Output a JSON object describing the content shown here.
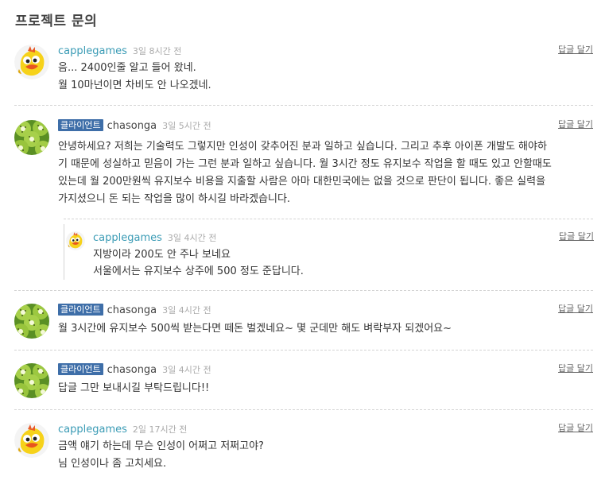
{
  "page": {
    "title": "프로젝트 문의"
  },
  "comments": [
    {
      "badge": "",
      "user": "capplegames",
      "time": "3일 8시간 전",
      "reply": "답글 달기",
      "lines": [
        "음... 2400인줄 알고 들어 왔네.",
        "월 10마넌이면 차비도 안 나오겠네."
      ]
    },
    {
      "badge": "클라이언트",
      "user": "chasonga",
      "time": "3일 5시간 전",
      "reply": "답글 달기",
      "lines": [
        "안녕하세요? 저희는 기술력도 그렇지만 인성이 갖추어진 분과 일하고 싶습니다. 그리고 추후 아이폰 개발도 해야하",
        "기 때문에 성실하고 믿음이 가는 그런 분과 일하고 싶습니다. 월 3시간 정도 유지보수 작업을 할 때도 있고 안할때도",
        "있는데 월 200만원씩 유지보수 비용을 지출할 사람은 아마 대한민국에는 없을 것으로 판단이 됩니다. 좋은 실력을",
        "가지셨으니 돈 되는 작업을 많이 하시길 바라겠습니다."
      ]
    },
    {
      "badge": "",
      "user": "capplegames",
      "time": "3일 4시간 전",
      "reply": "답글 달기",
      "lines": [
        "지방이라 200도 안 주나 보네요",
        "서울에서는 유지보수 상주에 500 정도 준답니다."
      ]
    },
    {
      "badge": "클라이언트",
      "user": "chasonga",
      "time": "3일 4시간 전",
      "reply": "답글 달기",
      "lines": [
        "월 3시간에 유지보수 500씩 받는다면 떼돈 벌겠네요~ 몇 군데만 해도 벼락부자 되겠어요~"
      ]
    },
    {
      "badge": "클라이언트",
      "user": "chasonga",
      "time": "3일 4시간 전",
      "reply": "답글 달기",
      "lines": [
        "답글 그만 보내시길 부탁드립니다!!"
      ]
    },
    {
      "badge": "",
      "user": "capplegames",
      "time": "2일 17시간 전",
      "reply": "답글 달기",
      "lines": [
        "금액 얘기 하는데 무슨 인성이 어쩌고 저쩌고야?",
        "님 인성이나 좀 고치세요."
      ]
    }
  ],
  "icons": {
    "capplegames_avatar": "yellow-bird-avatar-icon",
    "chasonga_avatar": "kiwi-avatar-icon"
  },
  "colors": {
    "badge": "#3e6ea8",
    "username": "#3a9bb5",
    "time": "#aaaaaa"
  }
}
